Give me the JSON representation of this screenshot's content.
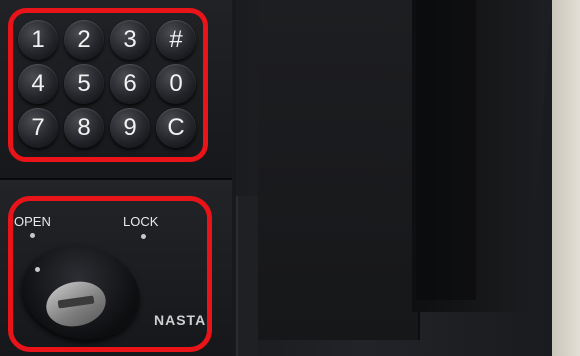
{
  "keypad": {
    "keys": [
      {
        "label": "1"
      },
      {
        "label": "2"
      },
      {
        "label": "3"
      },
      {
        "label": "#"
      },
      {
        "label": "4"
      },
      {
        "label": "5"
      },
      {
        "label": "6"
      },
      {
        "label": "0"
      },
      {
        "label": "7"
      },
      {
        "label": "8"
      },
      {
        "label": "9"
      },
      {
        "label": "C"
      }
    ]
  },
  "cylinder": {
    "open_label": "OPEN",
    "lock_label": "LOCK",
    "brand": "NASTA"
  },
  "highlight_color": "#e8141a"
}
